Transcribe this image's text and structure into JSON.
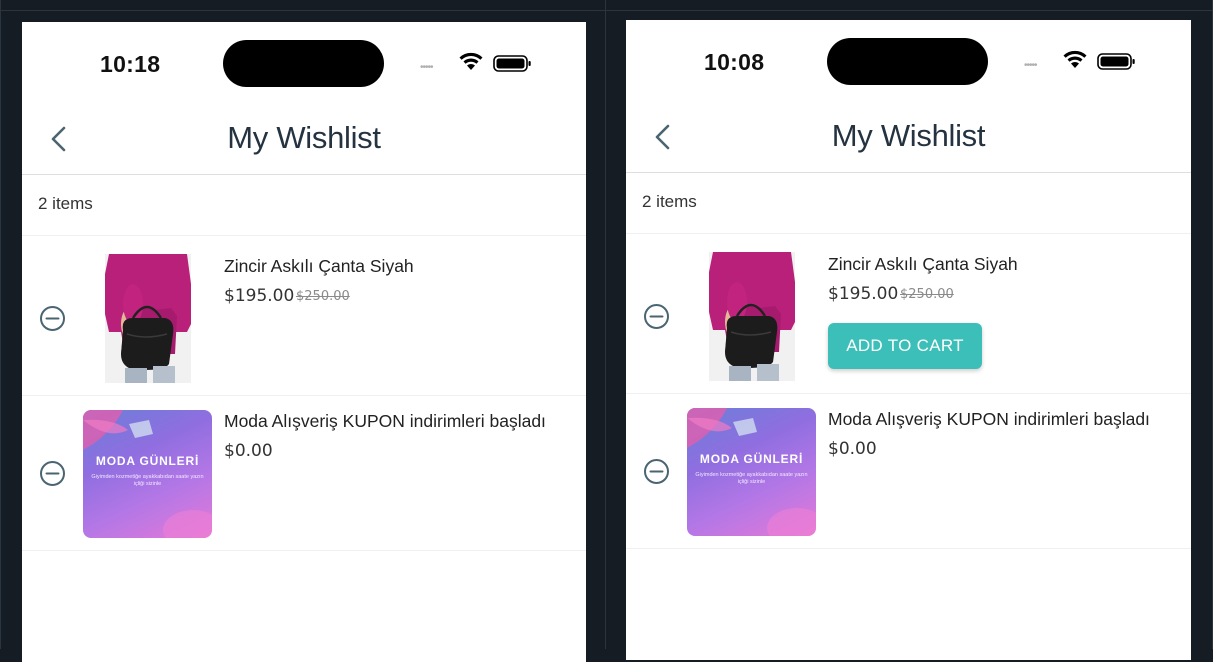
{
  "screens": [
    {
      "status_time": "10:18",
      "title": "My Wishlist",
      "item_count": "2 items",
      "items": [
        {
          "name": "Zincir Askılı Çanta Siyah",
          "price": "$195.00",
          "old_price": "$250.00"
        },
        {
          "name": "Moda Alışveriş KUPON indirimleri başladı",
          "price": "$0.00",
          "promo_title": "MODA GÜNLERİ",
          "promo_sub": "Giyimden kozmetiğe ayakkabıdan saate yazın içliği sizinle"
        }
      ]
    },
    {
      "status_time": "10:08",
      "title": "My Wishlist",
      "item_count": "2 items",
      "items": [
        {
          "name": "Zincir Askılı Çanta Siyah",
          "price": "$195.00",
          "old_price": "$250.00",
          "button_label": "ADD TO CART"
        },
        {
          "name": "Moda Alışveriş KUPON indirimleri başladı",
          "price": "$0.00",
          "promo_title": "MODA GÜNLERİ",
          "promo_sub": "Giyimden kozmetiğe ayakkabıdan saate yazın içliği sizinle"
        }
      ]
    }
  ],
  "colors": {
    "accent": "#3cbfb8",
    "title": "#253341",
    "background": "#161c24",
    "icon": "#4a6572"
  },
  "icons": [
    "back-chevron-icon",
    "remove-circle-icon",
    "wifi-icon",
    "battery-icon",
    "signal-dots-icon"
  ]
}
